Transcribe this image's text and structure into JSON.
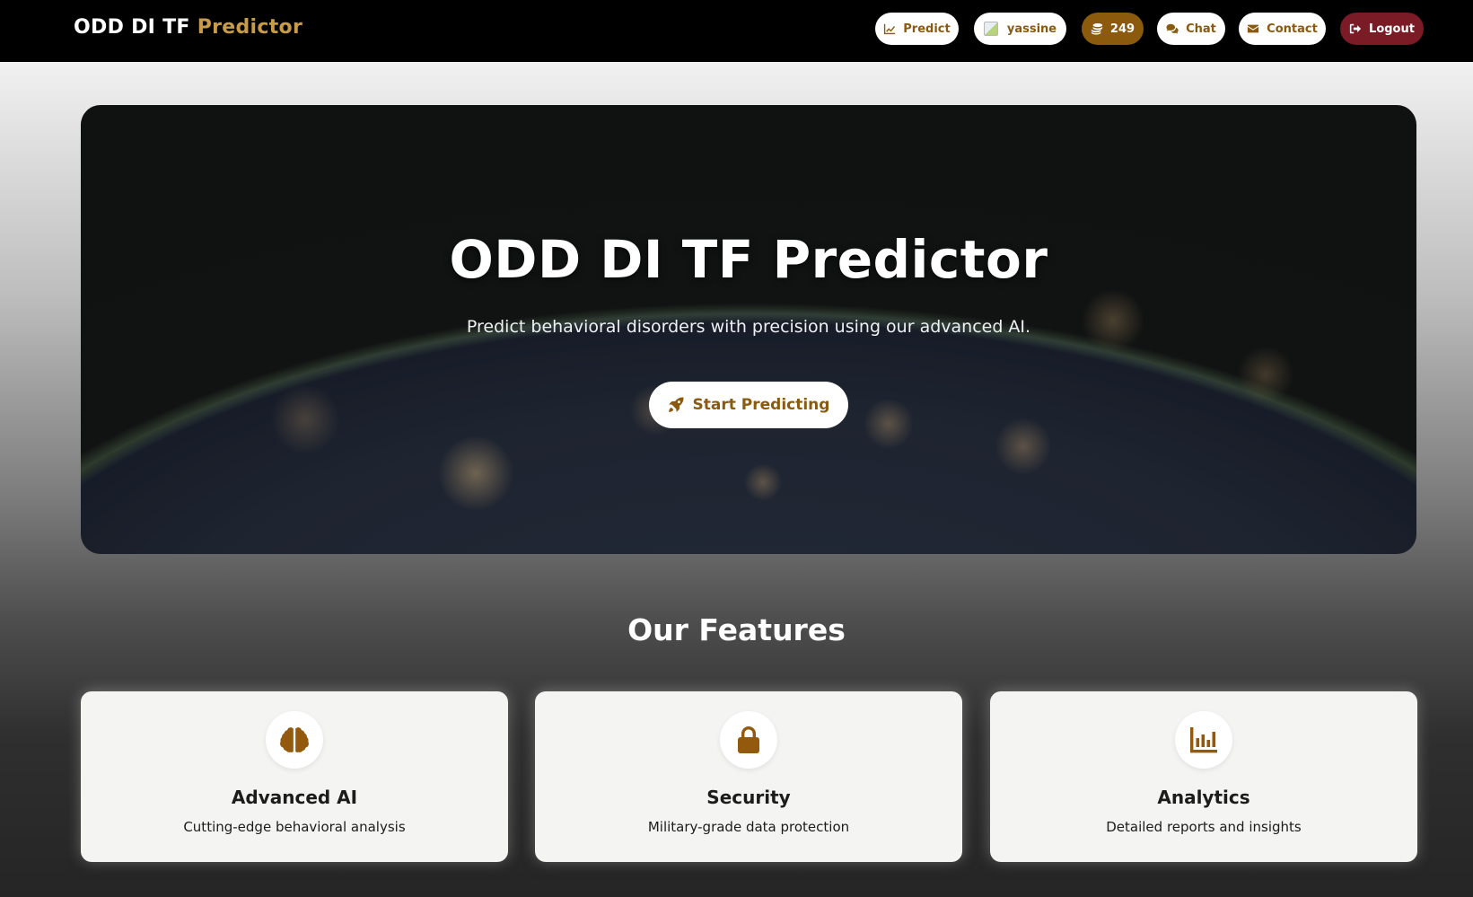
{
  "navbar": {
    "brand_main": "ODD DI TF",
    "brand_accent": "Predictor",
    "predict_label": "Predict",
    "user_name": "yassine",
    "coins": "249",
    "chat_label": "Chat",
    "contact_label": "Contact",
    "logout_label": "Logout"
  },
  "hero": {
    "title": "ODD DI TF Predictor",
    "subtitle": "Predict behavioral disorders with precision using our advanced AI.",
    "cta_label": "Start Predicting"
  },
  "features": {
    "heading": "Our Features",
    "items": [
      {
        "icon": "brain-icon",
        "title": "Advanced AI",
        "description": "Cutting-edge behavioral analysis"
      },
      {
        "icon": "lock-icon",
        "title": "Security",
        "description": "Military-grade data protection"
      },
      {
        "icon": "chart-bar-icon",
        "title": "Analytics",
        "description": "Detailed reports and insights"
      }
    ]
  },
  "colors": {
    "accent_gold": "#8b5a0c",
    "logout_red": "#7a1b26",
    "navbar_bg": "#000000"
  }
}
